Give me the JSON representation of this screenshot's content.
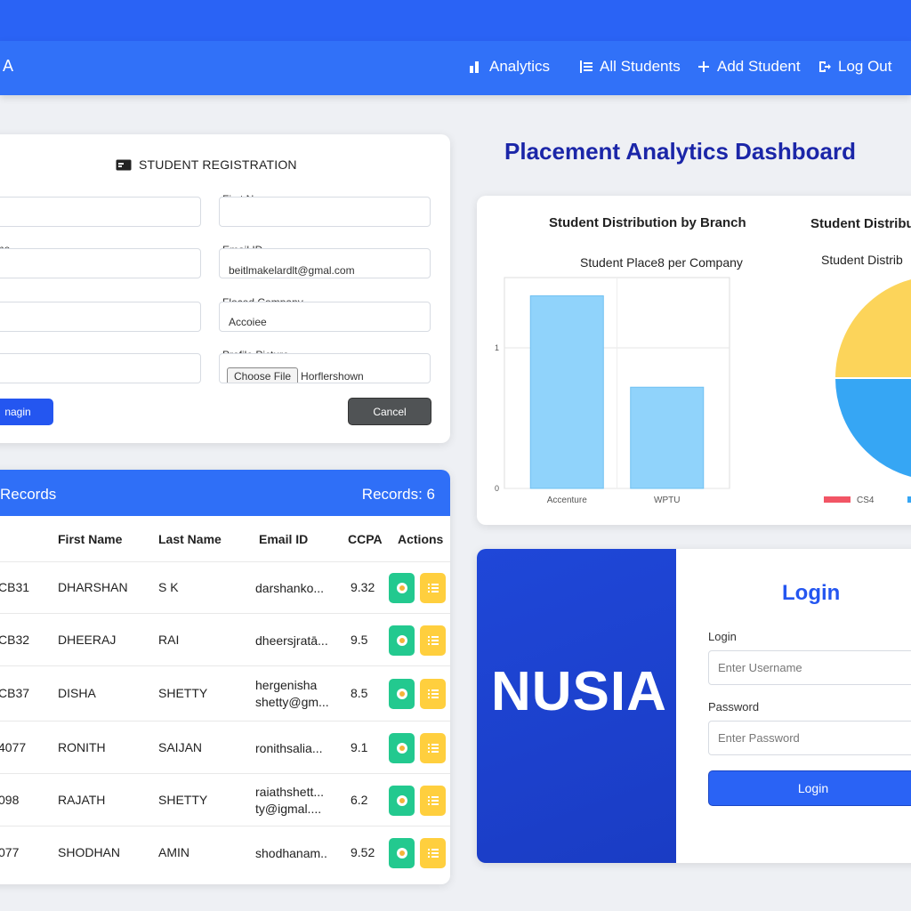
{
  "nav": {
    "brand": "A",
    "items": [
      {
        "label": "Analytics",
        "icon": "bar-chart-icon"
      },
      {
        "label": "All Students",
        "icon": "list-icon"
      },
      {
        "label": "Add Student",
        "icon": "plus-icon"
      },
      {
        "label": "Log Out",
        "icon": "logout-icon"
      }
    ]
  },
  "registration": {
    "title": "STUDENT REGISTRATION",
    "left_labels": [
      "ame",
      "n",
      "e"
    ],
    "fields": {
      "first_name": {
        "label": "First Name",
        "value": ""
      },
      "email": {
        "label": "Email ID",
        "value": "beitlmakelardlt@gmal.com"
      },
      "company": {
        "label": "Floced Company",
        "value": "Accoiee"
      },
      "picture": {
        "label": "Profile Picture",
        "button": "Choose File",
        "value": "Horflershown"
      }
    },
    "submit_label": "nagin",
    "cancel_label": "Cancel"
  },
  "records": {
    "title": "Records",
    "count_label": "Records: 6",
    "headers": [
      "First Name",
      "Last Name",
      "Email ID",
      "CCPA",
      "Actions"
    ],
    "rows": [
      {
        "id": "CB31",
        "first": "DHARSHAN",
        "last": "S K",
        "email": "darshanko...",
        "email2": "",
        "cgpa": "9.32"
      },
      {
        "id": "CB32",
        "first": "DHEERAJ",
        "last": "RAI",
        "email": "dheersjratā...",
        "email2": "",
        "cgpa": "9.5"
      },
      {
        "id": "CB37",
        "first": "DISHA",
        "last": "SHETTY",
        "email": "hergenisha",
        "email2": "shetty@gm...",
        "cgpa": "8.5"
      },
      {
        "id": "4077",
        "first": "RONITH",
        "last": "SAIJAN",
        "email": "ronithsalia...",
        "email2": "",
        "cgpa": "9.1"
      },
      {
        "id": "098",
        "first": "RAJATH",
        "last": "SHETTY",
        "email": "raiathshett...",
        "email2": "ty@igmal....",
        "cgpa": "6.2"
      },
      {
        "id": "077",
        "first": "SHODHAN",
        "last": "AMIN",
        "email": "shodhanam..",
        "email2": "",
        "cgpa": "9.52"
      }
    ]
  },
  "dashboard": {
    "title": "Placement Analytics Dashboard"
  },
  "chart_data": [
    {
      "type": "bar",
      "title": "Student Distribution by Branch",
      "subtitle": "Student Place8 per Company",
      "categories": [
        "Accenture",
        "WPTU"
      ],
      "values": [
        1.37,
        0.72
      ],
      "ylim": [
        0,
        1.5
      ],
      "yticks": [
        "0",
        "1"
      ],
      "color": "#90d3fb",
      "grid": true
    },
    {
      "type": "pie",
      "title": "Student Distribu",
      "subtitle": "Student Distrib",
      "slices": [
        {
          "name": "CS4",
          "value": 0.28,
          "color": "#f25565"
        },
        {
          "name": "",
          "value": 0.47,
          "color": "#36a6f4"
        },
        {
          "name": "",
          "value": 0.25,
          "color": "#fcd45a"
        }
      ],
      "legend_position": "bottom"
    }
  ],
  "login": {
    "logo": "NUSIA",
    "title": "Login",
    "username_label": "Login",
    "username_placeholder": "Enter Username",
    "password_label": "Password",
    "password_placeholder": "Enter Password",
    "button": "Login"
  }
}
